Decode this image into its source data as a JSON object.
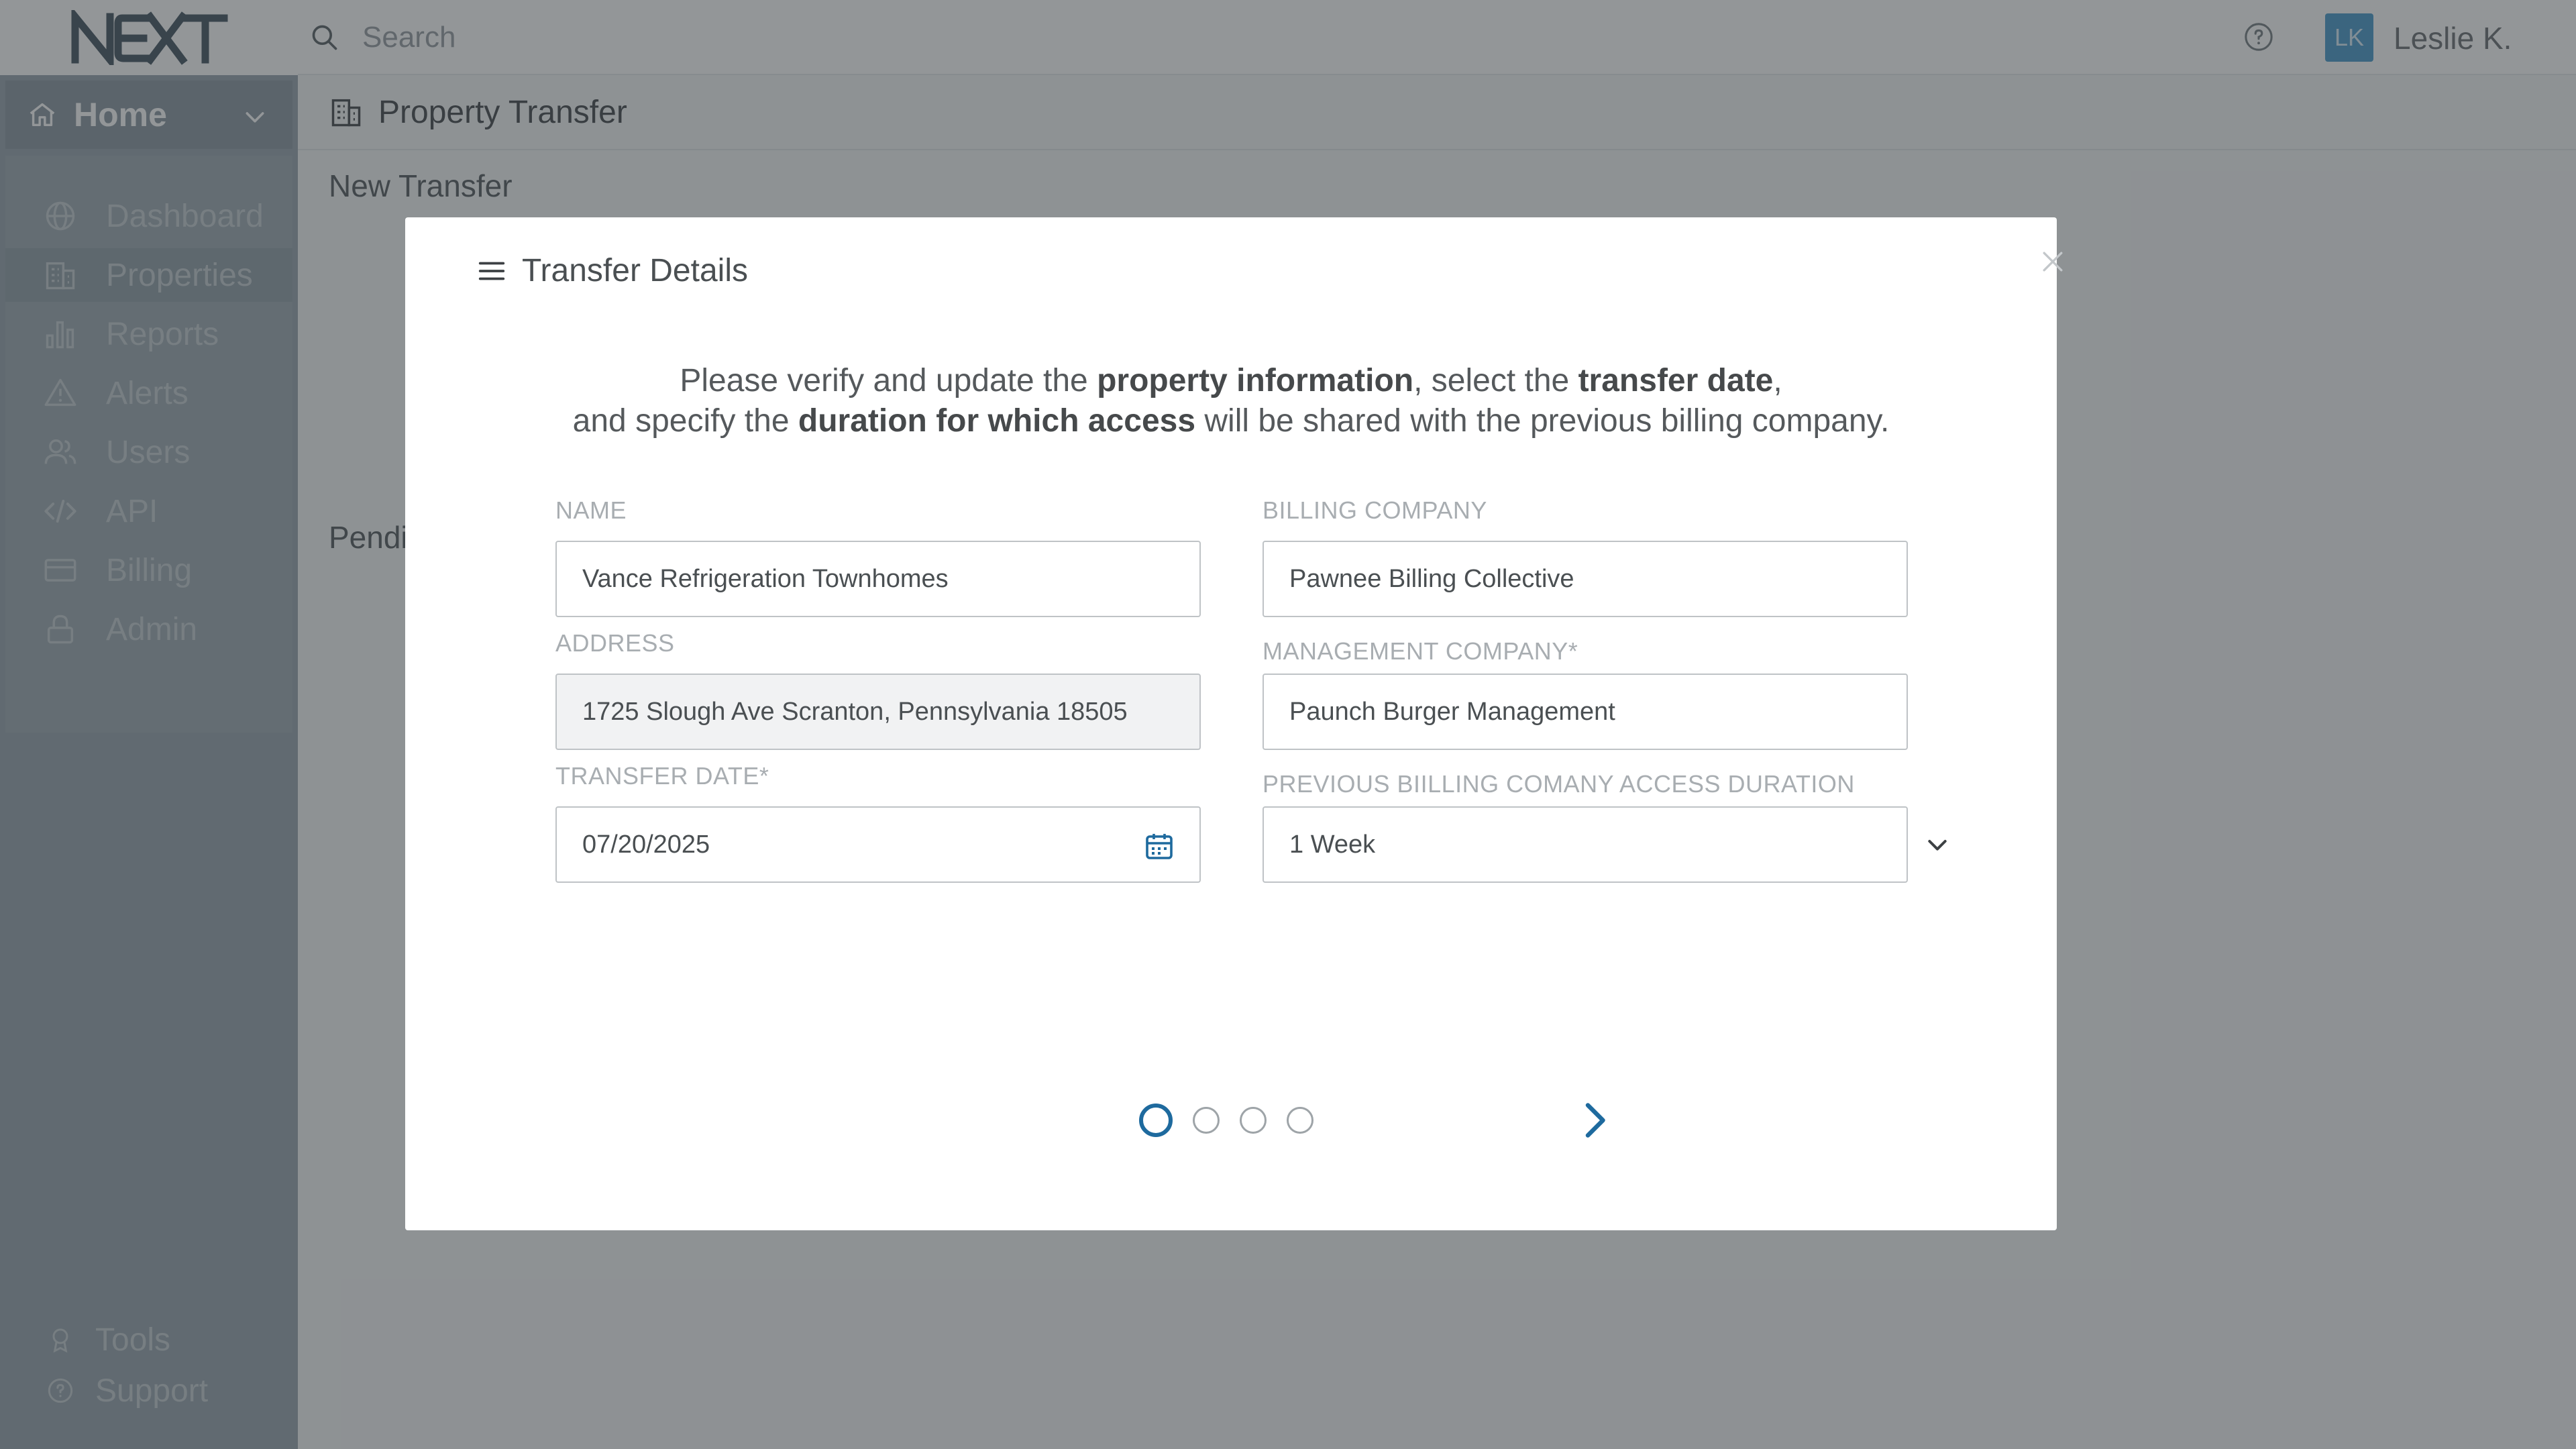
{
  "app": {
    "logo_text": "NEXT",
    "search_placeholder": "Search",
    "user": {
      "initials": "LK",
      "name": "Leslie K."
    }
  },
  "sidebar": {
    "home_label": "Home",
    "items": [
      {
        "label": "Dashboard",
        "icon": "globe-icon"
      },
      {
        "label": "Properties",
        "icon": "building-icon",
        "active": true
      },
      {
        "label": "Reports",
        "icon": "bar-chart-icon"
      },
      {
        "label": "Alerts",
        "icon": "warning-icon"
      },
      {
        "label": "Users",
        "icon": "users-icon"
      },
      {
        "label": "API",
        "icon": "code-icon"
      },
      {
        "label": "Billing",
        "icon": "credit-card-icon"
      },
      {
        "label": "Admin",
        "icon": "lock-icon"
      }
    ],
    "footer_items": [
      {
        "label": "Tools",
        "icon": "award-icon"
      },
      {
        "label": "Support",
        "icon": "help-circle-icon"
      }
    ]
  },
  "page": {
    "title": "Property Transfer",
    "section_new": "New Transfer",
    "section_pending": "Pendi"
  },
  "modal": {
    "title": "Transfer Details",
    "instructions": {
      "l1_a": "Please verify and update the ",
      "l1_b": "property information",
      "l1_c": ", select the ",
      "l1_d": "transfer date",
      "l1_e": ",",
      "l2_a": "and specify the ",
      "l2_b": "duration for which access",
      "l2_c": " will be shared with the previous billing company."
    },
    "fields": {
      "name": {
        "label": "NAME",
        "value": "Vance Refrigeration Townhomes"
      },
      "address": {
        "label": "ADDRESS",
        "value": "1725 Slough Ave Scranton, Pennsylvania 18505"
      },
      "transfer_date": {
        "label": "TRANSFER DATE*",
        "value": "07/20/2025"
      },
      "billing_company": {
        "label": "BILLING COMPANY",
        "value": "Pawnee Billing Collective"
      },
      "management_company": {
        "label": "MANAGEMENT COMPANY*",
        "value": "Paunch Burger Management"
      },
      "access_duration": {
        "label": "PREVIOUS BIILLING COMANY  ACCESS DURATION",
        "value": "1 Week"
      }
    },
    "steps": {
      "current": 1,
      "total": 4
    }
  },
  "colors": {
    "accent": "#1e6a9e",
    "avatar": "#4f9ccc",
    "overlay": "rgba(40,45,50,0.5)"
  }
}
